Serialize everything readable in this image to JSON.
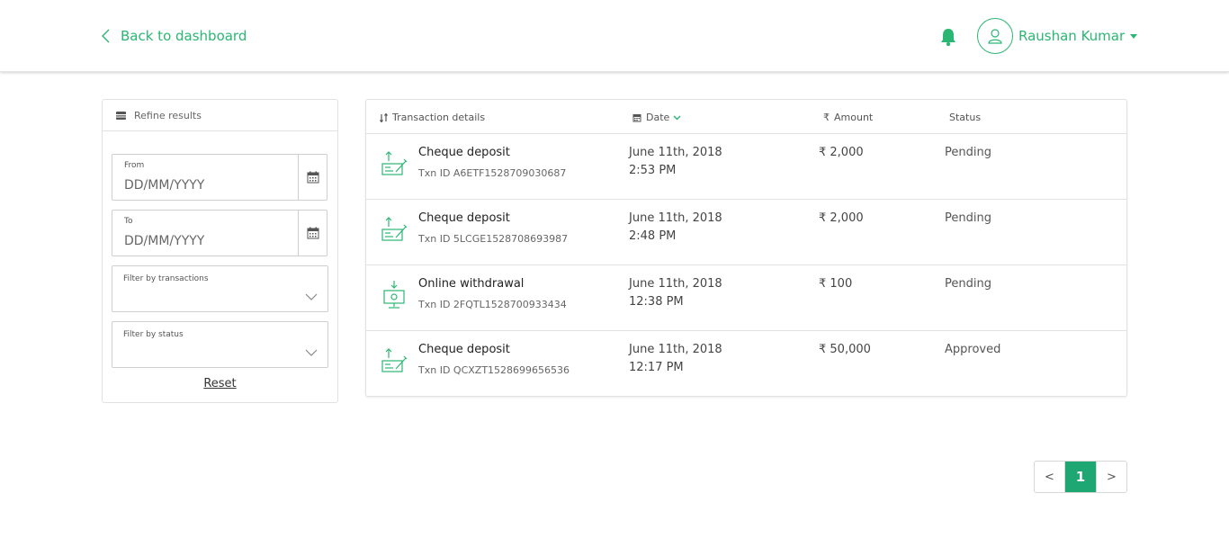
{
  "header": {
    "back_label": "Back to dashboard",
    "user_name": "Raushan Kumar"
  },
  "colors": {
    "accent": "#2bb673",
    "page_active": "#1fa773",
    "border": "#e2e2e2"
  },
  "filters": {
    "title": "Refine results",
    "from_label": "From",
    "from_placeholder": "DD/MM/YYYY",
    "to_label": "To",
    "to_placeholder": "DD/MM/YYYY",
    "transactions_label": "Filter by transactions",
    "status_label": "Filter by status",
    "reset_label": "Reset"
  },
  "table": {
    "headers": {
      "details": "Transaction details",
      "date": "Date",
      "amount": "Amount",
      "status": "Status"
    },
    "rows": [
      {
        "icon": "cheque-deposit-icon",
        "title": "Cheque deposit",
        "txn": "Txn ID A6ETF1528709030687",
        "date": "June 11th, 2018",
        "time": "2:53 PM",
        "amount": "₹ 2,000",
        "status": "Pending"
      },
      {
        "icon": "cheque-deposit-icon",
        "title": "Cheque deposit",
        "txn": "Txn ID 5LCGE1528708693987",
        "date": "June 11th, 2018",
        "time": "2:48 PM",
        "amount": "₹ 2,000",
        "status": "Pending"
      },
      {
        "icon": "online-withdrawal-icon",
        "title": "Online withdrawal",
        "txn": "Txn ID 2FQTL1528700933434",
        "date": "June 11th, 2018",
        "time": "12:38 PM",
        "amount": "₹ 100",
        "status": "Pending"
      },
      {
        "icon": "cheque-deposit-icon",
        "title": "Cheque deposit",
        "txn": "Txn ID QCXZT1528699656536",
        "date": "June 11th, 2018",
        "time": "12:17 PM",
        "amount": "₹ 50,000",
        "status": "Approved"
      }
    ]
  },
  "pagination": {
    "prev": "<",
    "current": "1",
    "next": ">"
  }
}
